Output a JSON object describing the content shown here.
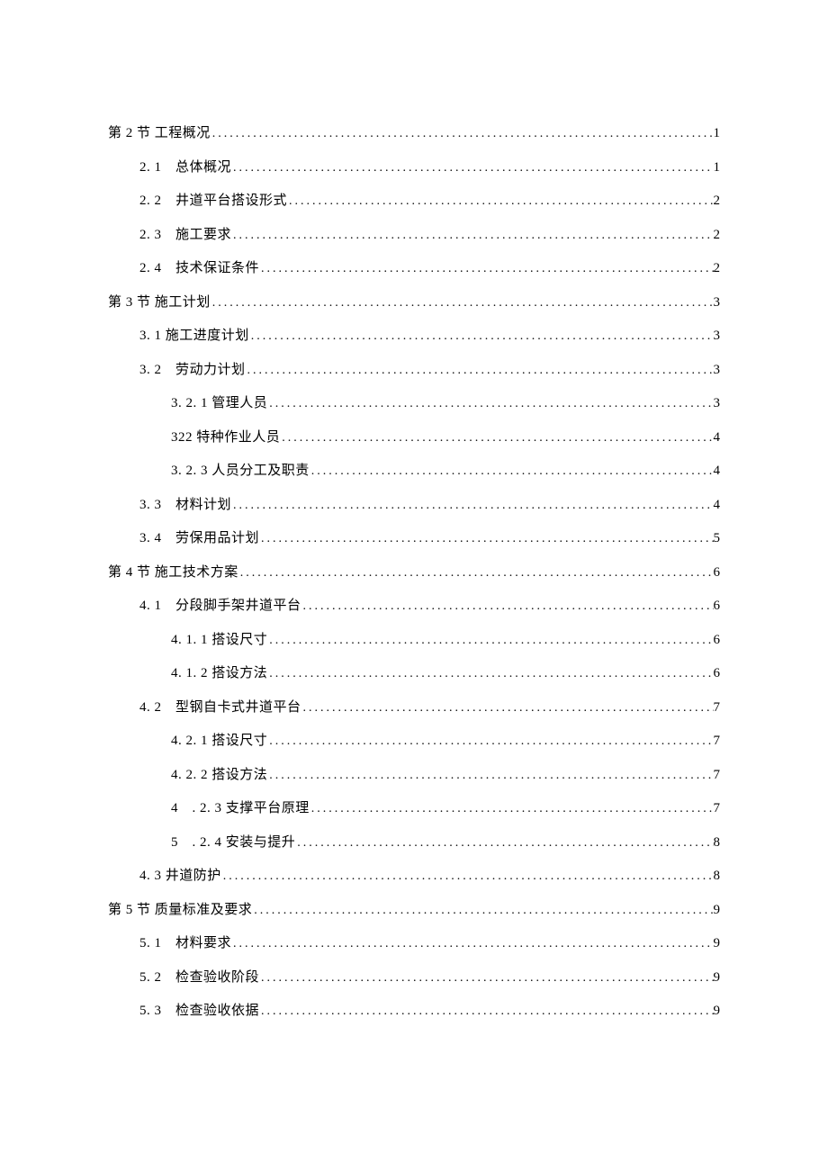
{
  "toc": [
    {
      "label": "第 2 节 工程概况",
      "page": "1",
      "indent": 0
    },
    {
      "label": "2. 1　总体概况",
      "page": "1",
      "indent": 1
    },
    {
      "label": "2. 2　井道平台搭设形式 ",
      "page": "2",
      "indent": 1
    },
    {
      "label": "2. 3　施工要求 ",
      "page": "2",
      "indent": 1
    },
    {
      "label": "2. 4　技术保证条件 ",
      "page": "2",
      "indent": 1
    },
    {
      "label": "第 3 节 施工计划",
      "page": "3",
      "indent": 0
    },
    {
      "label": "3. 1 施工进度计划",
      "page": "3",
      "indent": 1
    },
    {
      "label": "3. 2　劳动力计划 ",
      "page": "3",
      "indent": 1
    },
    {
      "label": "3. 2. 1 管理人员 ",
      "page": "3",
      "indent": 2
    },
    {
      "label": "322 特种作业人员 ",
      "page": "4",
      "indent": 2
    },
    {
      "label": "3. 2. 3 人员分工及职责 ",
      "page": "4",
      "indent": 2
    },
    {
      "label": "3. 3　材料计划 ",
      "page": "4",
      "indent": 1
    },
    {
      "label": "3. 4　劳保用品计划 ",
      "page": "5",
      "indent": 1
    },
    {
      "label": "第 4 节 施工技术方案",
      "page": "6",
      "indent": 0
    },
    {
      "label": "4. 1　分段脚手架井道平台",
      "page": "6",
      "indent": 1
    },
    {
      "label": "4. 1. 1 搭设尺寸 ",
      "page": "6",
      "indent": 2
    },
    {
      "label": "4. 1. 2 搭设方法",
      "page": "6",
      "indent": 2
    },
    {
      "label": "4. 2　型钢自卡式井道平台 ",
      "page": "7",
      "indent": 1
    },
    {
      "label": "4. 2. 1 搭设尺寸 ",
      "page": "7",
      "indent": 2
    },
    {
      "label": "4. 2. 2 搭设方法",
      "page": "7",
      "indent": 2
    },
    {
      "label": "4　. 2. 3 支撑平台原理 ",
      "page": "7",
      "indent": 2
    },
    {
      "label": "5　. 2. 4 安装与提升 ",
      "page": "8",
      "indent": 2
    },
    {
      "label": "4. 3 井道防护",
      "page": "8",
      "indent": 1
    },
    {
      "label": "第 5 节 质量标准及要求",
      "page": "9",
      "indent": 0
    },
    {
      "label": "5. 1　材料要求",
      "page": "9",
      "indent": 1
    },
    {
      "label": "5. 2　检查验收阶段 ",
      "page": "9",
      "indent": 1
    },
    {
      "label": "5. 3　检查验收依据 ",
      "page": "9",
      "indent": 1
    }
  ]
}
